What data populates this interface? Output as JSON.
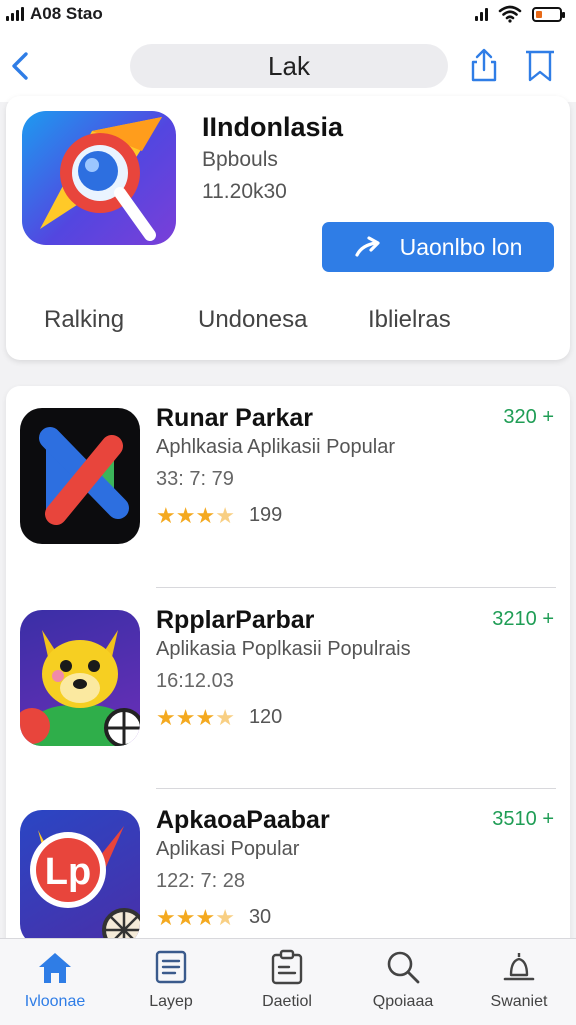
{
  "status_bar": {
    "carrier": "A08 Stao"
  },
  "nav": {
    "search_text": "Lak"
  },
  "featured": {
    "title": "IIndonlasia",
    "subtitle": "Bpbouls",
    "number": "11.20k30",
    "install_label": "Uaonlbo lon",
    "tabs": [
      "Ralking",
      "Undonesa",
      "Iblielras"
    ]
  },
  "apps": [
    {
      "title": "Runar Parkar",
      "subtitle": "Aphlkasia Aplikasii Popular",
      "meta": "33: 7: 79",
      "rating": 3.5,
      "reviews": "199",
      "price": "320 +",
      "icon": "x-cross-app-icon"
    },
    {
      "title": "RpplarParbar",
      "subtitle": "Aplikasia Poplkasii Populrais",
      "meta": "16:12.03",
      "rating": 3.5,
      "reviews": "120",
      "price": "3210 +",
      "icon": "fox-app-icon"
    },
    {
      "title": "ApkaoaPaabar",
      "subtitle": "Aplikasi Popular",
      "meta": "122: 7: 28",
      "rating": 3.5,
      "reviews": "30",
      "price": "3510 +",
      "icon": "compass-app-icon"
    }
  ],
  "tabbar": {
    "items": [
      {
        "label": "Ivloonae",
        "icon": "home-icon"
      },
      {
        "label": "Layep",
        "icon": "list-icon"
      },
      {
        "label": "Daetiol",
        "icon": "clipboard-icon"
      },
      {
        "label": "Qpoiaaa",
        "icon": "search-icon"
      },
      {
        "label": "Swaniet",
        "icon": "bell-icon"
      }
    ]
  },
  "colors": {
    "accent": "#2f7de6",
    "price": "#1f9d55",
    "star": "#f4a91f"
  }
}
